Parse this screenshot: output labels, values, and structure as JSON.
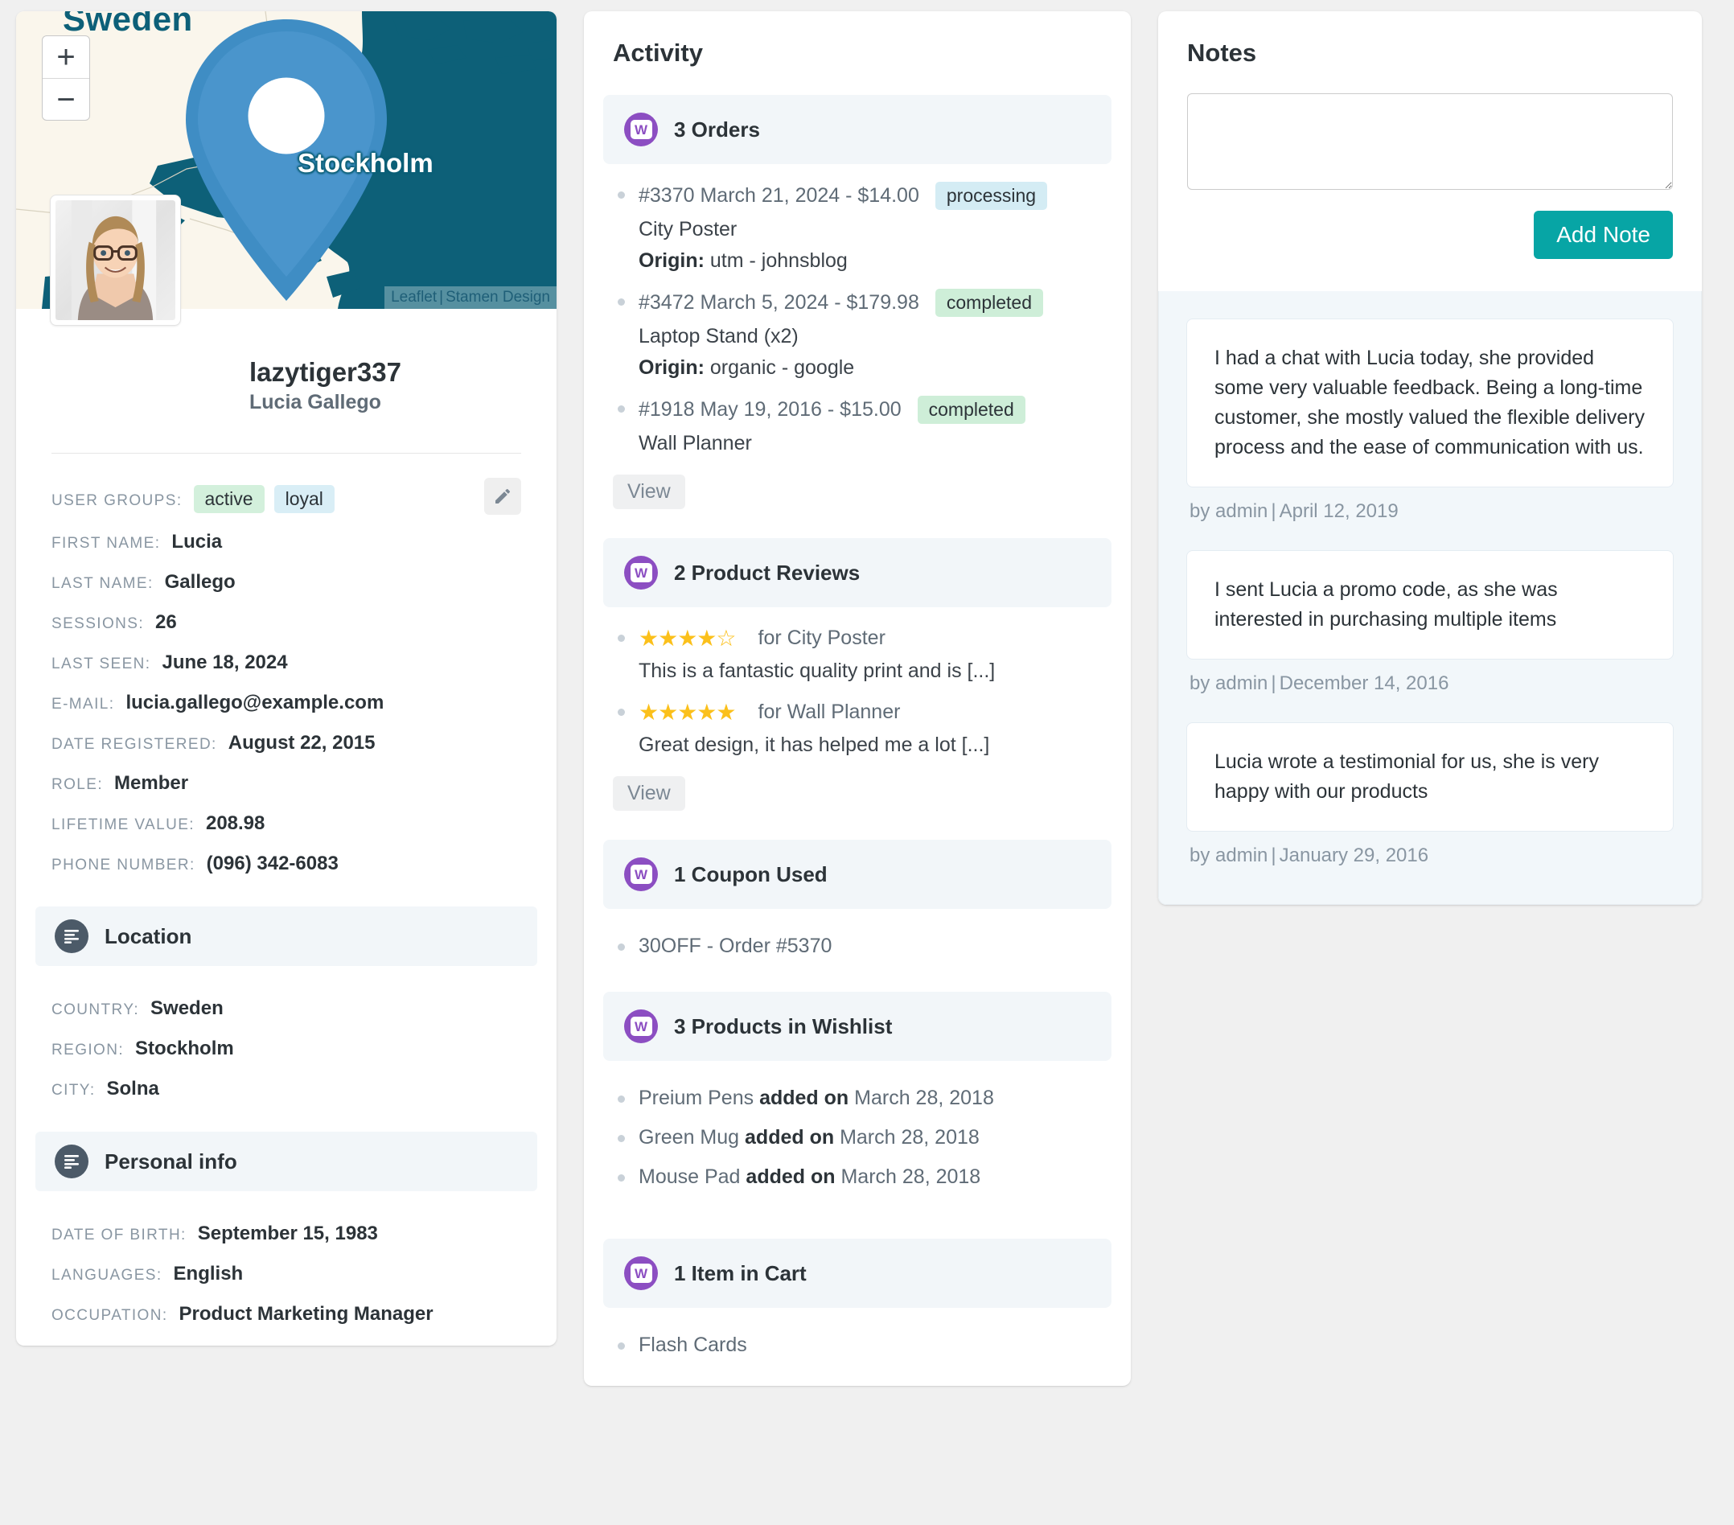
{
  "profile": {
    "map": {
      "country_label": "Sweden",
      "city_label": "Stockholm",
      "zoom_in": "+",
      "zoom_out": "−",
      "attribution_leaflet": "Leaflet",
      "attribution_sep": "|",
      "attribution_provider": "Stamen Design"
    },
    "username": "lazytiger337",
    "fullname": "Lucia Gallego",
    "fields": [
      {
        "label": "USER GROUPS:",
        "chips": [
          {
            "text": "active",
            "color": "green"
          },
          {
            "text": "loyal",
            "color": "blue"
          }
        ]
      },
      {
        "label": "FIRST NAME:",
        "value": "Lucia"
      },
      {
        "label": "LAST NAME:",
        "value": "Gallego"
      },
      {
        "label": "SESSIONS:",
        "value": "26"
      },
      {
        "label": "LAST SEEN:",
        "value": "June 18, 2024"
      },
      {
        "label": "E-MAIL:",
        "value": "lucia.gallego@example.com"
      },
      {
        "label": "DATE REGISTERED:",
        "value": "August 22, 2015"
      },
      {
        "label": "ROLE:",
        "value": "Member"
      },
      {
        "label": "LIFETIME VALUE:",
        "value": "208.98"
      },
      {
        "label": "PHONE NUMBER:",
        "value": "(096) 342-6083"
      }
    ],
    "location": {
      "title": "Location",
      "fields": [
        {
          "label": "COUNTRY:",
          "value": "Sweden"
        },
        {
          "label": "REGION:",
          "value": "Stockholm"
        },
        {
          "label": "CITY:",
          "value": "Solna"
        }
      ]
    },
    "personal_info": {
      "title": "Personal info",
      "fields": [
        {
          "label": "DATE OF BIRTH:",
          "value": "September 15, 1983"
        },
        {
          "label": "LANGUAGES:",
          "value": "English"
        },
        {
          "label": "OCCUPATION:",
          "value": "Product Marketing Manager"
        }
      ]
    }
  },
  "activity": {
    "title": "Activity",
    "view_label": "View",
    "orders": {
      "heading": "3 Orders",
      "items": [
        {
          "main": "#3370 March 21, 2024 - $14.00",
          "status": "processing",
          "status_color": "processing",
          "product": "City Poster",
          "origin_label": "Origin:",
          "origin_value": "utm - johnsblog"
        },
        {
          "main": "#3472 March 5, 2024 - $179.98",
          "status": "completed",
          "status_color": "completed",
          "product": "Laptop Stand (x2)",
          "origin_label": "Origin:",
          "origin_value": "organic - google"
        },
        {
          "main": "#1918 May 19, 2016 - $15.00",
          "status": "completed",
          "status_color": "completed",
          "product": "Wall Planner",
          "origin_label": "",
          "origin_value": ""
        }
      ]
    },
    "reviews": {
      "heading": "2 Product Reviews",
      "items": [
        {
          "stars_filled": 4,
          "stars_total": 5,
          "for": "for City Poster",
          "excerpt": "This is a fantastic quality print and is [...]"
        },
        {
          "stars_filled": 5,
          "stars_total": 5,
          "for": "for Wall Planner",
          "excerpt": "Great design, it has helped me a lot [...]"
        }
      ]
    },
    "coupons": {
      "heading": "1 Coupon Used",
      "items": [
        {
          "text": "30OFF - Order #5370"
        }
      ]
    },
    "wishlist": {
      "heading": "3 Products in Wishlist",
      "items": [
        {
          "product": "Preium Pens",
          "mid": "added on",
          "date": "March 28, 2018"
        },
        {
          "product": "Green Mug",
          "mid": "added on",
          "date": "March 28, 2018"
        },
        {
          "product": "Mouse Pad",
          "mid": "added on",
          "date": "March 28, 2018"
        }
      ]
    },
    "cart": {
      "heading": "1 Item in Cart",
      "items": [
        {
          "text": "Flash Cards"
        }
      ]
    }
  },
  "notes": {
    "title": "Notes",
    "textarea_value": "",
    "textarea_placeholder": "",
    "add_button": "Add Note",
    "items": [
      {
        "text": "I had a chat with Lucia today, she provided some very valuable feedback. Being a long-time customer, she mostly valued the flexible delivery process and the ease of communication with us.",
        "author": "by admin",
        "sep": "|",
        "date": "April 12, 2019"
      },
      {
        "text": "I sent Lucia a promo code, as she was interested in purchasing multiple items",
        "author": "by admin",
        "sep": "|",
        "date": "December 14, 2016"
      },
      {
        "text": "Lucia wrote a testimonial for us, she is very happy with our products",
        "author": "by admin",
        "sep": "|",
        "date": "January 29, 2016"
      }
    ]
  },
  "colors": {
    "accent_teal": "#07a5a5",
    "woo_purple": "#8c4ec2",
    "map_water": "#0d6078",
    "map_land": "#faf6ec",
    "badge_processing": "#d4ecf4",
    "badge_completed": "#ceeed8",
    "chip_active": "#d3f0dc",
    "chip_loyal": "#d9eef6"
  }
}
